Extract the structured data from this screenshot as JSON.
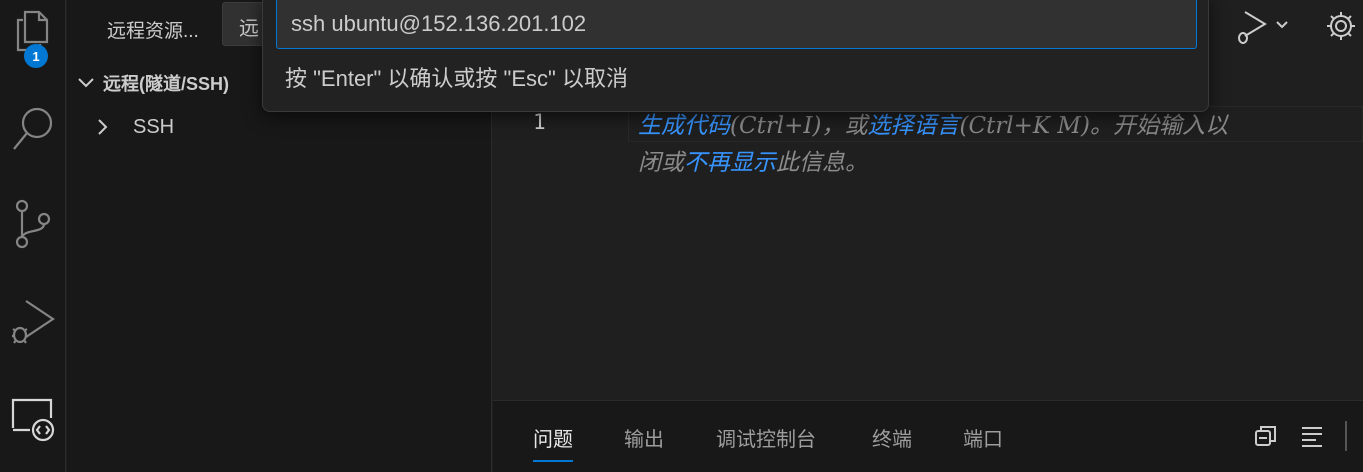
{
  "activity_bar": {
    "explorer_badge": "1"
  },
  "sidebar": {
    "title": "远程资源...",
    "remote_select_value": "远",
    "section_title": "远程(隧道/SSH)",
    "tree_items": [
      {
        "label": "SSH"
      }
    ]
  },
  "quick_input": {
    "value": "ssh ubuntu@152.136.201.102",
    "message": "按 \"Enter\" 以确认或按 \"Esc\" 以取消"
  },
  "editor": {
    "line_number": "1",
    "hint": {
      "part1_link": "生成代码",
      "part2": "(Ctrl+I)，或",
      "part3_link": "选择语言",
      "part4": "(Ctrl+K M)。开始输入以",
      "line2_part1": "闭或",
      "line2_link": "不再显示",
      "line2_part2": "此信息。"
    }
  },
  "panel": {
    "tabs": [
      {
        "label": "问题",
        "active": true
      },
      {
        "label": "输出",
        "active": false
      },
      {
        "label": "调试控制台",
        "active": false
      },
      {
        "label": "终端",
        "active": false
      },
      {
        "label": "端口",
        "active": false
      }
    ]
  },
  "colors": {
    "accent": "#0078d4",
    "link": "#3794ff",
    "background": "#1f1f1f",
    "sidebar_background": "#181818"
  }
}
